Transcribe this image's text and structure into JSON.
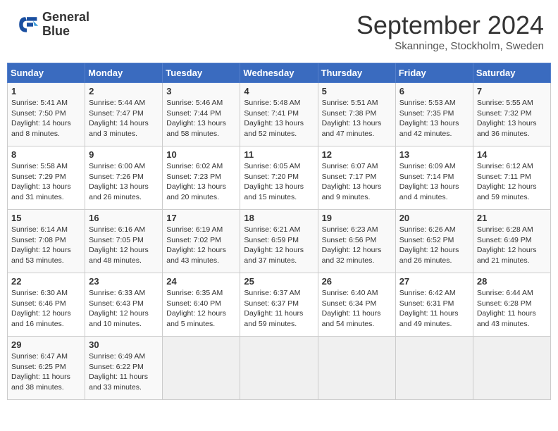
{
  "header": {
    "logo_line1": "General",
    "logo_line2": "Blue",
    "title": "September 2024",
    "location": "Skanninge, Stockholm, Sweden"
  },
  "weekdays": [
    "Sunday",
    "Monday",
    "Tuesday",
    "Wednesday",
    "Thursday",
    "Friday",
    "Saturday"
  ],
  "weeks": [
    [
      {
        "day": "1",
        "sunrise": "5:41 AM",
        "sunset": "7:50 PM",
        "daylight": "14 hours and 8 minutes."
      },
      {
        "day": "2",
        "sunrise": "5:44 AM",
        "sunset": "7:47 PM",
        "daylight": "14 hours and 3 minutes."
      },
      {
        "day": "3",
        "sunrise": "5:46 AM",
        "sunset": "7:44 PM",
        "daylight": "13 hours and 58 minutes."
      },
      {
        "day": "4",
        "sunrise": "5:48 AM",
        "sunset": "7:41 PM",
        "daylight": "13 hours and 52 minutes."
      },
      {
        "day": "5",
        "sunrise": "5:51 AM",
        "sunset": "7:38 PM",
        "daylight": "13 hours and 47 minutes."
      },
      {
        "day": "6",
        "sunrise": "5:53 AM",
        "sunset": "7:35 PM",
        "daylight": "13 hours and 42 minutes."
      },
      {
        "day": "7",
        "sunrise": "5:55 AM",
        "sunset": "7:32 PM",
        "daylight": "13 hours and 36 minutes."
      }
    ],
    [
      {
        "day": "8",
        "sunrise": "5:58 AM",
        "sunset": "7:29 PM",
        "daylight": "13 hours and 31 minutes."
      },
      {
        "day": "9",
        "sunrise": "6:00 AM",
        "sunset": "7:26 PM",
        "daylight": "13 hours and 26 minutes."
      },
      {
        "day": "10",
        "sunrise": "6:02 AM",
        "sunset": "7:23 PM",
        "daylight": "13 hours and 20 minutes."
      },
      {
        "day": "11",
        "sunrise": "6:05 AM",
        "sunset": "7:20 PM",
        "daylight": "13 hours and 15 minutes."
      },
      {
        "day": "12",
        "sunrise": "6:07 AM",
        "sunset": "7:17 PM",
        "daylight": "13 hours and 9 minutes."
      },
      {
        "day": "13",
        "sunrise": "6:09 AM",
        "sunset": "7:14 PM",
        "daylight": "13 hours and 4 minutes."
      },
      {
        "day": "14",
        "sunrise": "6:12 AM",
        "sunset": "7:11 PM",
        "daylight": "12 hours and 59 minutes."
      }
    ],
    [
      {
        "day": "15",
        "sunrise": "6:14 AM",
        "sunset": "7:08 PM",
        "daylight": "12 hours and 53 minutes."
      },
      {
        "day": "16",
        "sunrise": "6:16 AM",
        "sunset": "7:05 PM",
        "daylight": "12 hours and 48 minutes."
      },
      {
        "day": "17",
        "sunrise": "6:19 AM",
        "sunset": "7:02 PM",
        "daylight": "12 hours and 43 minutes."
      },
      {
        "day": "18",
        "sunrise": "6:21 AM",
        "sunset": "6:59 PM",
        "daylight": "12 hours and 37 minutes."
      },
      {
        "day": "19",
        "sunrise": "6:23 AM",
        "sunset": "6:56 PM",
        "daylight": "12 hours and 32 minutes."
      },
      {
        "day": "20",
        "sunrise": "6:26 AM",
        "sunset": "6:52 PM",
        "daylight": "12 hours and 26 minutes."
      },
      {
        "day": "21",
        "sunrise": "6:28 AM",
        "sunset": "6:49 PM",
        "daylight": "12 hours and 21 minutes."
      }
    ],
    [
      {
        "day": "22",
        "sunrise": "6:30 AM",
        "sunset": "6:46 PM",
        "daylight": "12 hours and 16 minutes."
      },
      {
        "day": "23",
        "sunrise": "6:33 AM",
        "sunset": "6:43 PM",
        "daylight": "12 hours and 10 minutes."
      },
      {
        "day": "24",
        "sunrise": "6:35 AM",
        "sunset": "6:40 PM",
        "daylight": "12 hours and 5 minutes."
      },
      {
        "day": "25",
        "sunrise": "6:37 AM",
        "sunset": "6:37 PM",
        "daylight": "11 hours and 59 minutes."
      },
      {
        "day": "26",
        "sunrise": "6:40 AM",
        "sunset": "6:34 PM",
        "daylight": "11 hours and 54 minutes."
      },
      {
        "day": "27",
        "sunrise": "6:42 AM",
        "sunset": "6:31 PM",
        "daylight": "11 hours and 49 minutes."
      },
      {
        "day": "28",
        "sunrise": "6:44 AM",
        "sunset": "6:28 PM",
        "daylight": "11 hours and 43 minutes."
      }
    ],
    [
      {
        "day": "29",
        "sunrise": "6:47 AM",
        "sunset": "6:25 PM",
        "daylight": "11 hours and 38 minutes."
      },
      {
        "day": "30",
        "sunrise": "6:49 AM",
        "sunset": "6:22 PM",
        "daylight": "11 hours and 33 minutes."
      },
      null,
      null,
      null,
      null,
      null
    ]
  ]
}
